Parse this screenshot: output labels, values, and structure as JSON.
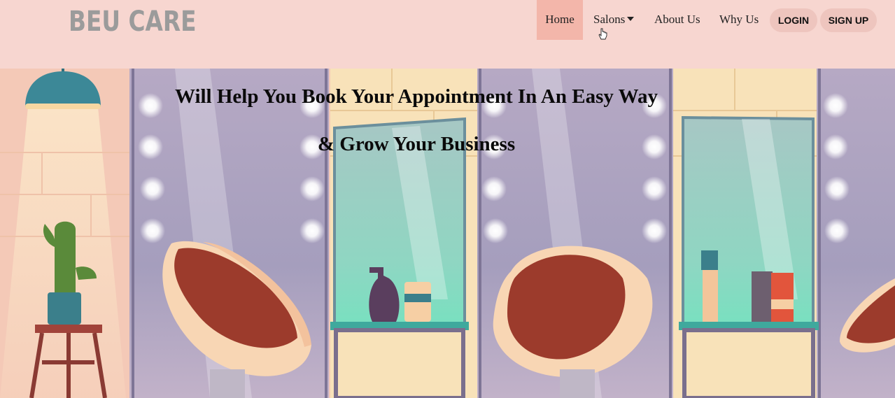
{
  "brand": {
    "logo_text": "BEU CARE"
  },
  "nav": {
    "home": "Home",
    "salons": "Salons",
    "about": "About Us",
    "why": "Why Us",
    "login": "LOGIN",
    "signup": "SIGN UP"
  },
  "hero": {
    "line1": "Will Help You Book Your Appointment In An Easy Way",
    "line2": "& Grow Your Business"
  },
  "colors": {
    "header_bg": "#f7d6d0",
    "active_nav_bg": "#f3b6aa",
    "pill_bg": "#eec5be",
    "logo": "#9b9b9b"
  }
}
